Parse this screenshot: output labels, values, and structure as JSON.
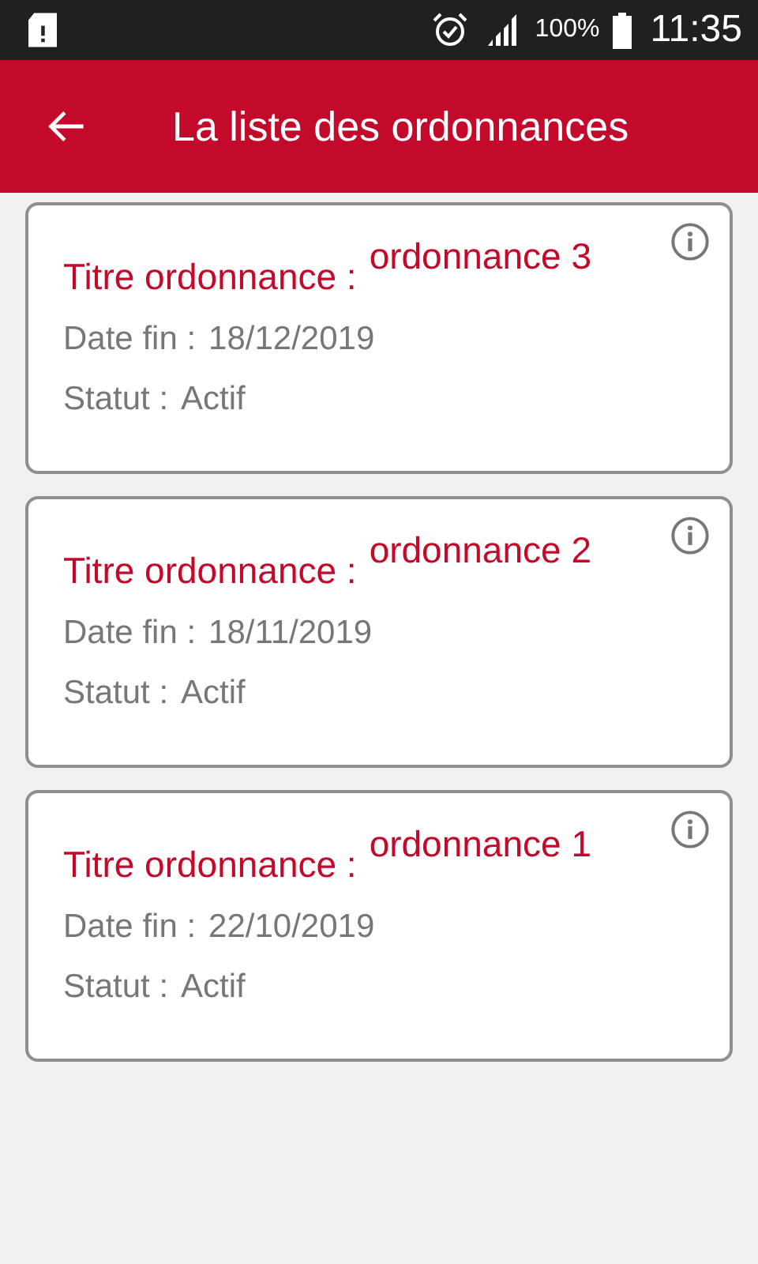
{
  "status_bar": {
    "battery": "100%",
    "time": "11:35"
  },
  "app_bar": {
    "title": "La liste des ordonnances"
  },
  "prescriptions": [
    {
      "title_label": "Titre ordonnance :",
      "title": "ordonnance 3",
      "date_label": "Date fin :",
      "date": "18/12/2019",
      "status_label": "Statut :",
      "status": "Actif"
    },
    {
      "title_label": "Titre ordonnance :",
      "title": "ordonnance 2",
      "date_label": "Date fin :",
      "date": "18/11/2019",
      "status_label": "Statut :",
      "status": "Actif"
    },
    {
      "title_label": "Titre ordonnance :",
      "title": "ordonnance 1",
      "date_label": "Date fin :",
      "date": "22/10/2019",
      "status_label": "Statut :",
      "status": "Actif"
    }
  ]
}
